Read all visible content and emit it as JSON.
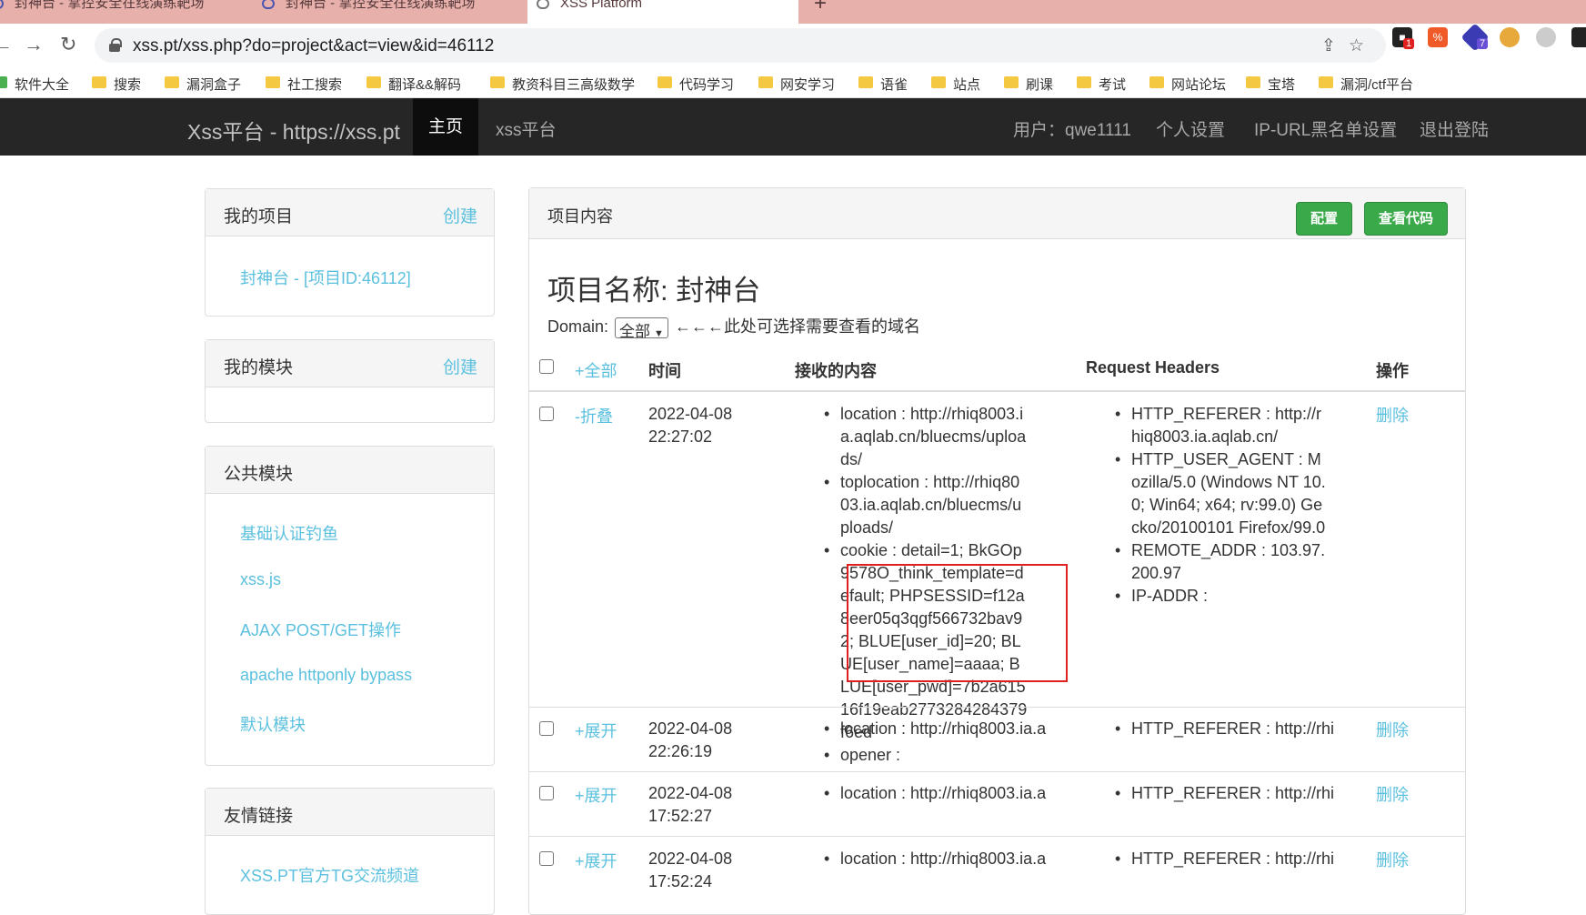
{
  "browser": {
    "tabs": [
      {
        "title": "封神台 - 掌控安全在线演练靶场",
        "close": "×"
      },
      {
        "title": "封神台 - 掌控安全在线演练靶场",
        "close": "×"
      },
      {
        "title": "XSS Platform",
        "close": "×"
      }
    ],
    "new_tab": "+",
    "url": "xss.pt/xss.php?do=project&act=view&id=46112",
    "bookmarks": [
      "软件大全",
      "搜索",
      "漏洞盒子",
      "社工搜索",
      "翻译&&解码",
      "教资科目三高级数学",
      "代码学习",
      "网安学习",
      "语雀",
      "站点",
      "刷课",
      "考试",
      "网站论坛",
      "宝塔",
      "漏洞/ctf平台"
    ],
    "extension_badges": [
      "1",
      "7"
    ]
  },
  "navbar": {
    "brand": "Xss平台 - https://xss.pt",
    "home": "主页",
    "xss": "xss平台",
    "user": "用户：qwe1111",
    "settings": "个人设置",
    "blacklist": "IP-URL黑名单设置",
    "logout": "退出登陆"
  },
  "sidebar": {
    "my_projects": {
      "title": "我的项目",
      "create": "创建",
      "items": [
        "封神台 - [项目ID:46112]"
      ]
    },
    "my_modules": {
      "title": "我的模块",
      "create": "创建"
    },
    "public_modules": {
      "title": "公共模块",
      "items": [
        "基础认证钓鱼",
        "xss.js",
        "AJAX POST/GET操作",
        "apache httponly bypass",
        "默认模块"
      ]
    },
    "links": {
      "title": "友情链接",
      "items": [
        "XSS.PT官方TG交流频道"
      ]
    }
  },
  "main": {
    "title": "项目内容",
    "config_btn": "配置",
    "view_code_btn": "查看代码",
    "project_name": "项目名称: 封神台",
    "domain_label": "Domain:",
    "domain_value": "全部",
    "domain_hint": "←←←此处可选择需要查看的域名",
    "columns": {
      "toggle_all": "+全部",
      "time": "时间",
      "content": "接收的内容",
      "headers": "Request Headers",
      "action": "操作"
    },
    "rows": [
      {
        "toggle": "-折叠",
        "date": "2022-04-08",
        "time": "22:27:02",
        "content": [
          "location : http://rhiq8003.ia.aqlab.cn/bluecms/uploads/",
          "toplocation : http://rhiq8003.ia.aqlab.cn/bluecms/uploads/",
          "cookie : detail=1; BkGOp9578O_think_template=default; PHPSESSID=f12a8eer05q3qgf566732bav92; BLUE[user_id]=20; BLUE[user_name]=aaaa; BLUE[user_pwd]=7b2a61516f19eab2773284284379f6ed",
          "opener :"
        ],
        "headers": [
          "HTTP_REFERER : http://rhiq8003.ia.aqlab.cn/",
          "HTTP_USER_AGENT : Mozilla/5.0 (Windows NT 10.0; Win64; x64; rv:99.0) Gecko/20100101 Firefox/99.0",
          "REMOTE_ADDR : 103.97.200.97",
          "IP-ADDR :"
        ],
        "action": "删除"
      },
      {
        "toggle": "+展开",
        "date": "2022-04-08",
        "time": "22:26:19",
        "content": [
          "location : http://rhiq8003.ia.a"
        ],
        "headers": [
          "HTTP_REFERER : http://rhi"
        ],
        "action": "删除"
      },
      {
        "toggle": "+展开",
        "date": "2022-04-08",
        "time": "17:52:27",
        "content": [
          "location : http://rhiq8003.ia.a"
        ],
        "headers": [
          "HTTP_REFERER : http://rhi"
        ],
        "action": "删除"
      },
      {
        "toggle": "+展开",
        "date": "2022-04-08",
        "time": "17:52:24",
        "content": [
          "location : http://rhiq8003.ia.a"
        ],
        "headers": [
          "HTTP_REFERER : http://rhi"
        ],
        "action": "删除"
      }
    ]
  }
}
